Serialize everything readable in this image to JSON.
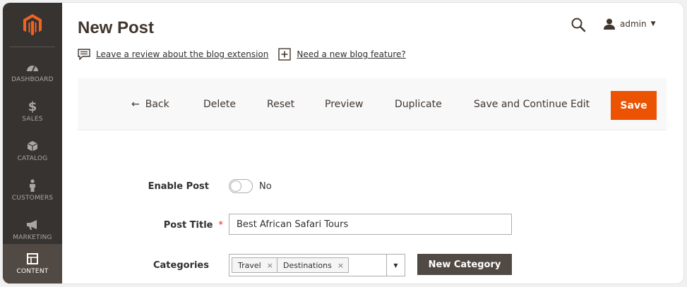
{
  "sidebar": {
    "logo": "magento-logo",
    "items": [
      {
        "label": "DASHBOARD",
        "icon": "dashboard-icon"
      },
      {
        "label": "SALES",
        "icon": "dollar-icon"
      },
      {
        "label": "CATALOG",
        "icon": "box-icon"
      },
      {
        "label": "CUSTOMERS",
        "icon": "person-icon"
      },
      {
        "label": "MARKETING",
        "icon": "megaphone-icon"
      },
      {
        "label": "CONTENT",
        "icon": "layout-icon",
        "active": true
      }
    ]
  },
  "header": {
    "title": "New Post",
    "user": "admin",
    "links": {
      "review": "Leave a review about the blog extension",
      "feature": "Need a new blog feature?"
    }
  },
  "actions": {
    "back": "Back",
    "delete": "Delete",
    "reset": "Reset",
    "preview": "Preview",
    "duplicate": "Duplicate",
    "save_continue": "Save and Continue Edit",
    "save": "Save"
  },
  "form": {
    "enable_post": {
      "label": "Enable Post",
      "value": "No"
    },
    "post_title": {
      "label": "Post Title",
      "value": "Best African Safari Tours"
    },
    "categories": {
      "label": "Categories",
      "selected": [
        "Travel",
        "Destinations"
      ],
      "new_button": "New Category"
    }
  },
  "colors": {
    "sidebar_bg": "#373330",
    "sidebar_active": "#514943",
    "primary_button": "#eb5202",
    "secondary_button": "#514943"
  }
}
